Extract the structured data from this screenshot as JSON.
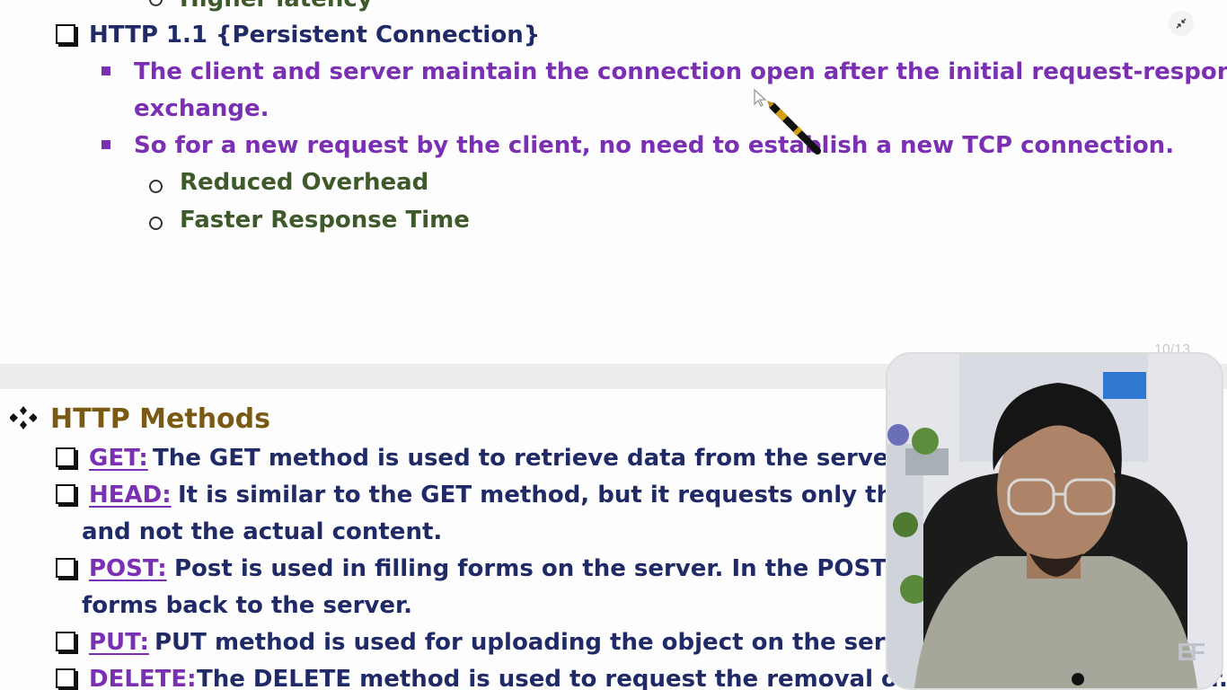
{
  "slide_top": {
    "cut_text": "Higher latency",
    "heading": "HTTP 1.1 {Persistent Connection}",
    "bullets": [
      {
        "line1": "The client and server maintain the connection open after the initial request-response",
        "line2": "exchange."
      },
      {
        "line1": "So for a new request by the client, no need to establish a new TCP connection."
      }
    ],
    "sub_items": [
      "Reduced Overhead",
      "Faster Response Time"
    ],
    "page_number": "10/13"
  },
  "slide_bottom": {
    "title": "HTTP Methods",
    "methods": [
      {
        "label": "GET:",
        "text": "The GET method is used to retrieve data from the server."
      },
      {
        "label": "HEAD:",
        "text": "It is similar to the GET method, but it requests only the",
        "cont": "and not the actual content."
      },
      {
        "label": "POST:",
        "text": "Post is used in filling forms on the server. In the POST",
        "cont": "forms back to the server."
      },
      {
        "label": "PUT:",
        "text": "PUT method is used for uploading the object on the server."
      },
      {
        "label": "DELETE:",
        "text": "The DELETE method is used to request the removal of an object on the server."
      }
    ]
  },
  "webcam": {
    "logo_text": "EF"
  },
  "icons": {
    "shrink": "exit-fullscreen-icon",
    "pen": "fountain-pen-cursor-icon",
    "pointer": "pointer-cursor-icon"
  },
  "colors": {
    "navy": "#1f2a66",
    "purple": "#7b2fb3",
    "olive": "#3f5a2a",
    "gold": "#7a5a13"
  }
}
